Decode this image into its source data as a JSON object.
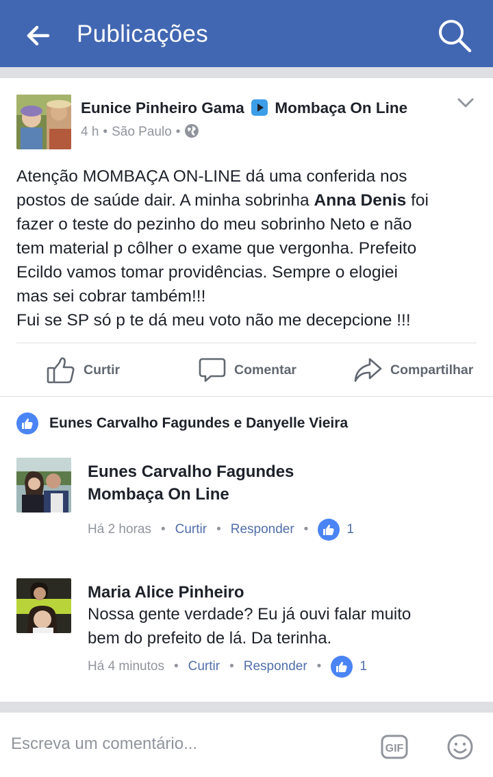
{
  "header": {
    "title": "Publicações",
    "back_icon": "back-arrow-icon",
    "search_icon": "search-icon",
    "bg_color": "#4267b2"
  },
  "post": {
    "author": "Eunice Pinheiro Gama",
    "page": "Mombaça On Line",
    "time": "4 h",
    "location": "São Paulo",
    "audience_icon": "globe-icon",
    "lines": [
      {
        "pre": "Atenção  MOMBAÇA ON-LINE  dá  uma conferida  nos",
        "bold": "",
        "post": ""
      },
      {
        "pre": "postos de saúde  dair. A minha sobrinha ",
        "bold": "Anna Denis",
        "post": "  foi"
      },
      {
        "pre": "fazer o teste do pezinho do meu sobrinho Neto e não",
        "bold": "",
        "post": ""
      },
      {
        "pre": "tem material p côlher o exame  que vergonha.  Prefeito",
        "bold": "",
        "post": ""
      },
      {
        "pre": "Ecildo vamos tomar providências. Sempre  o elogiei",
        "bold": "",
        "post": ""
      },
      {
        "pre": "mas sei cobrar também!!!",
        "bold": "",
        "post": ""
      },
      {
        "pre": "Fui se SP só  p te dá  meu voto não  me decepcione !!!",
        "bold": "",
        "post": ""
      }
    ]
  },
  "actions": {
    "like": "Curtir",
    "comment": "Comentar",
    "share": "Compartilhar"
  },
  "likers": "Eunes Carvalho Fagundes e Danyelle Vieira",
  "comments": [
    {
      "name": "Eunes Carvalho Fagundes",
      "text": "Mombaça On Line",
      "time": "Há 2 horas",
      "like": "Curtir",
      "reply": "Responder",
      "likes": "1"
    },
    {
      "name": "Maria Alice Pinheiro",
      "text1": "Nossa gente verdade? Eu já ouvi falar muito",
      "text2": "bem do prefeito de lá. Da terinha.",
      "time": "Há 4 minutos",
      "like": "Curtir",
      "reply": "Responder",
      "likes": "1"
    }
  ],
  "composer": {
    "placeholder": "Escreva um comentário...",
    "gif_label": "GIF"
  },
  "colors": {
    "accent": "#4267b2",
    "like_blue": "#4a84f5",
    "link": "#506eaa",
    "meta_gray": "#90949c"
  }
}
